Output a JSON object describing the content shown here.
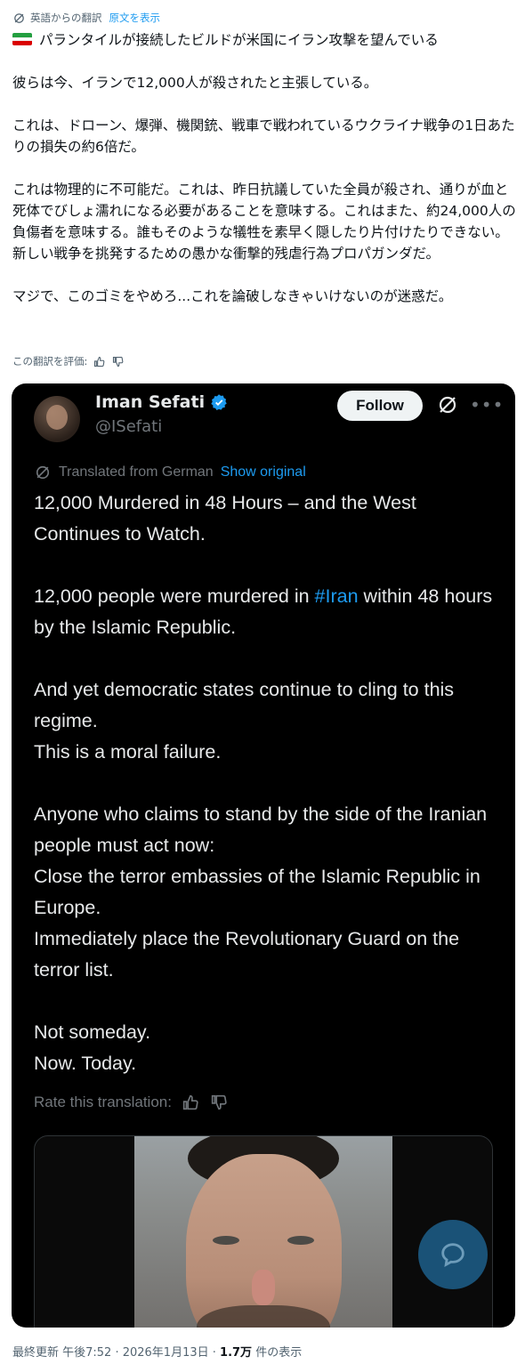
{
  "translation_note": {
    "label": "英語からの翻訳",
    "show_original": "原文を表示"
  },
  "post": {
    "flag": "Iran flag",
    "paragraphs": [
      "パランタイルが接続したビルドが米国にイラン攻撃を望んでいる",
      "彼らは今、イランで12,000人が殺されたと主張している。",
      "これは、ドローン、爆弾、機関銃、戦車で戦われているウクライナ戦争の1日あたりの損失の約6倍だ。",
      "これは物理的に不可能だ。これは、昨日抗議していた全員が殺され、通りが血と死体でびしょ濡れになる必要があることを意味する。これはまた、約24,000人の負傷者を意味する。誰もそのような犠牲を素早く隠したり片付けたりできない。新しい戦争を挑発するための愚かな衝撃的残虐行為プロパガンダだ。",
      "マジで、このゴミをやめろ...これを論破しなきゃいけないのが迷惑だ。"
    ]
  },
  "rate_translation_ja": "この翻訳を評価:",
  "embedded_tweet": {
    "display_name": "Iman Sefati",
    "handle": "@ISefati",
    "follow_label": "Follow",
    "translated_from": "Translated from German",
    "show_original": "Show original",
    "title_line": "12,000 Murdered in 48 Hours – and the West Continues to Watch.",
    "p2_before": "12,000 people were murdered in ",
    "hashtag": "#Iran",
    "p2_after": " within 48 hours by the Islamic Republic.",
    "p3_line1": "And yet democratic states continue to cling to this regime.",
    "p3_line2": "This is a moral failure.",
    "p4_line1": "Anyone who claims to stand by the side of the Iranian people must act now:",
    "p4_line2": "Close the terror embassies of the Islamic Republic in Europe.",
    "p4_line3": "Immediately place the Revolutionary Guard on the terror list.",
    "p5_line1": "Not someday.",
    "p5_line2": "Now. Today.",
    "rate_label": "Rate this translation:"
  },
  "footer": {
    "prefix": "最終更新 午後7:52 · 2026年1月13日 · ",
    "views": "1.7万",
    "suffix": " 件の表示"
  },
  "colors": {
    "accent": "#1d9bf0",
    "dark_bg": "#000000",
    "muted": "#536471"
  }
}
